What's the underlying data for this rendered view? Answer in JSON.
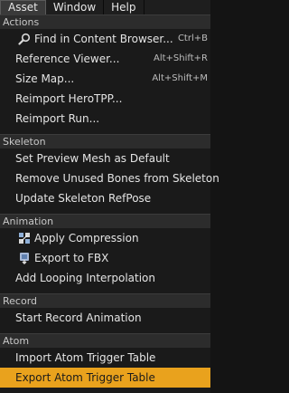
{
  "menubar": {
    "items": [
      {
        "label": "Asset"
      },
      {
        "label": "Window"
      },
      {
        "label": "Help"
      }
    ]
  },
  "sections": {
    "actions": {
      "header": "Actions",
      "items": [
        {
          "label": "Find in Content Browser...",
          "shortcut": "Ctrl+B",
          "icon": "magnifier-icon"
        },
        {
          "label": "Reference Viewer...",
          "shortcut": "Alt+Shift+R"
        },
        {
          "label": "Size Map...",
          "shortcut": "Alt+Shift+M"
        },
        {
          "label": "Reimport HeroTPP..."
        },
        {
          "label": "Reimport Run..."
        }
      ]
    },
    "skeleton": {
      "header": "Skeleton",
      "items": [
        {
          "label": "Set Preview Mesh as Default"
        },
        {
          "label": "Remove Unused Bones from Skeleton"
        },
        {
          "label": "Update Skeleton RefPose"
        }
      ]
    },
    "animation": {
      "header": "Animation",
      "items": [
        {
          "label": "Apply Compression",
          "icon": "compression-icon"
        },
        {
          "label": "Export to FBX",
          "icon": "export-fbx-icon"
        },
        {
          "label": "Add Looping Interpolation"
        }
      ]
    },
    "record": {
      "header": "Record",
      "items": [
        {
          "label": "Start Record Animation"
        }
      ]
    },
    "atom": {
      "header": "Atom",
      "items": [
        {
          "label": "Import Atom Trigger Table"
        },
        {
          "label": "Export Atom Trigger Table"
        }
      ]
    }
  },
  "colors": {
    "highlight": "#e9a21d",
    "menu_bg": "#1a1a1a",
    "header_bg": "#2c2c2c"
  }
}
